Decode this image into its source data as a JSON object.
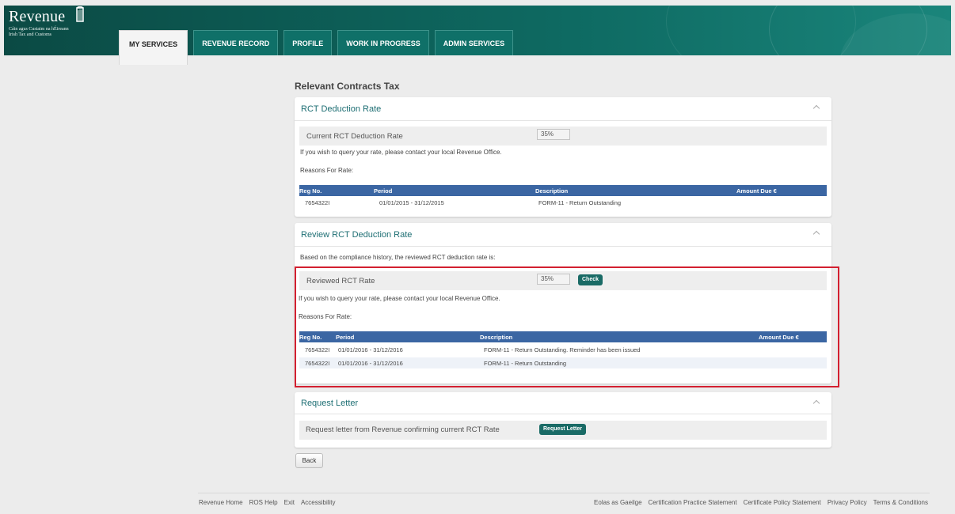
{
  "brand": {
    "name": "Revenue",
    "sub_line1": "Cáin agus Custaim na hÉireann",
    "sub_line2": "Irish Tax and Customs",
    "color": "#0e6a62"
  },
  "nav": {
    "tabs": [
      {
        "label": "MY SERVICES"
      },
      {
        "label": "REVENUE RECORD"
      },
      {
        "label": "PROFILE"
      },
      {
        "label": "WORK IN PROGRESS"
      },
      {
        "label": "ADMIN SERVICES"
      }
    ]
  },
  "page": {
    "title": "Relevant Contracts Tax"
  },
  "deduction": {
    "header": "RCT Deduction Rate",
    "current_label": "Current RCT Deduction Rate",
    "current_value": "35%",
    "query_note": "If you wish to query your rate, please contact your local Revenue Office.",
    "reasons_label": "Reasons For Rate:",
    "columns": [
      "Reg No.",
      "Period",
      "Description",
      "Amount Due €"
    ],
    "rows": [
      {
        "reg": "7654322I",
        "period": "01/01/2015 - 31/12/2015",
        "desc": "FORM-11 - Return Outstanding",
        "amount": ""
      }
    ]
  },
  "review": {
    "header": "Review RCT Deduction Rate",
    "intro": "Based on the compliance history, the reviewed RCT deduction rate is:",
    "reviewed_label": "Reviewed RCT Rate",
    "reviewed_value": "35%",
    "check_label": "Check",
    "query_note": "If you wish to query your rate, please contact your local Revenue Office.",
    "reasons_label": "Reasons For Rate:",
    "columns": [
      "Reg No.",
      "Period",
      "Description",
      "Amount Due €"
    ],
    "rows": [
      {
        "reg": "7654322I",
        "period": "01/01/2016 - 31/12/2016",
        "desc": "FORM-11 - Return Outstanding. Reminder has been issued",
        "amount": ""
      },
      {
        "reg": "7654322I",
        "period": "01/01/2016 - 31/12/2016",
        "desc": "FORM-11 - Return Outstanding",
        "amount": ""
      }
    ]
  },
  "letter": {
    "header": "Request Letter",
    "label": "Request letter from Revenue confirming current RCT Rate",
    "button": "Request Letter"
  },
  "back_label": "Back",
  "footer": {
    "left": [
      "Revenue Home",
      "ROS Help",
      "Exit",
      "Accessibility"
    ],
    "right": [
      "Eolas as Gaeilge",
      "Certification Practice Statement",
      "Certificate Policy Statement",
      "Privacy Policy",
      "Terms & Conditions"
    ]
  },
  "colors": {
    "table_header": "#3b66a3",
    "highlight": "#d32030",
    "button": "#1a6b66"
  }
}
